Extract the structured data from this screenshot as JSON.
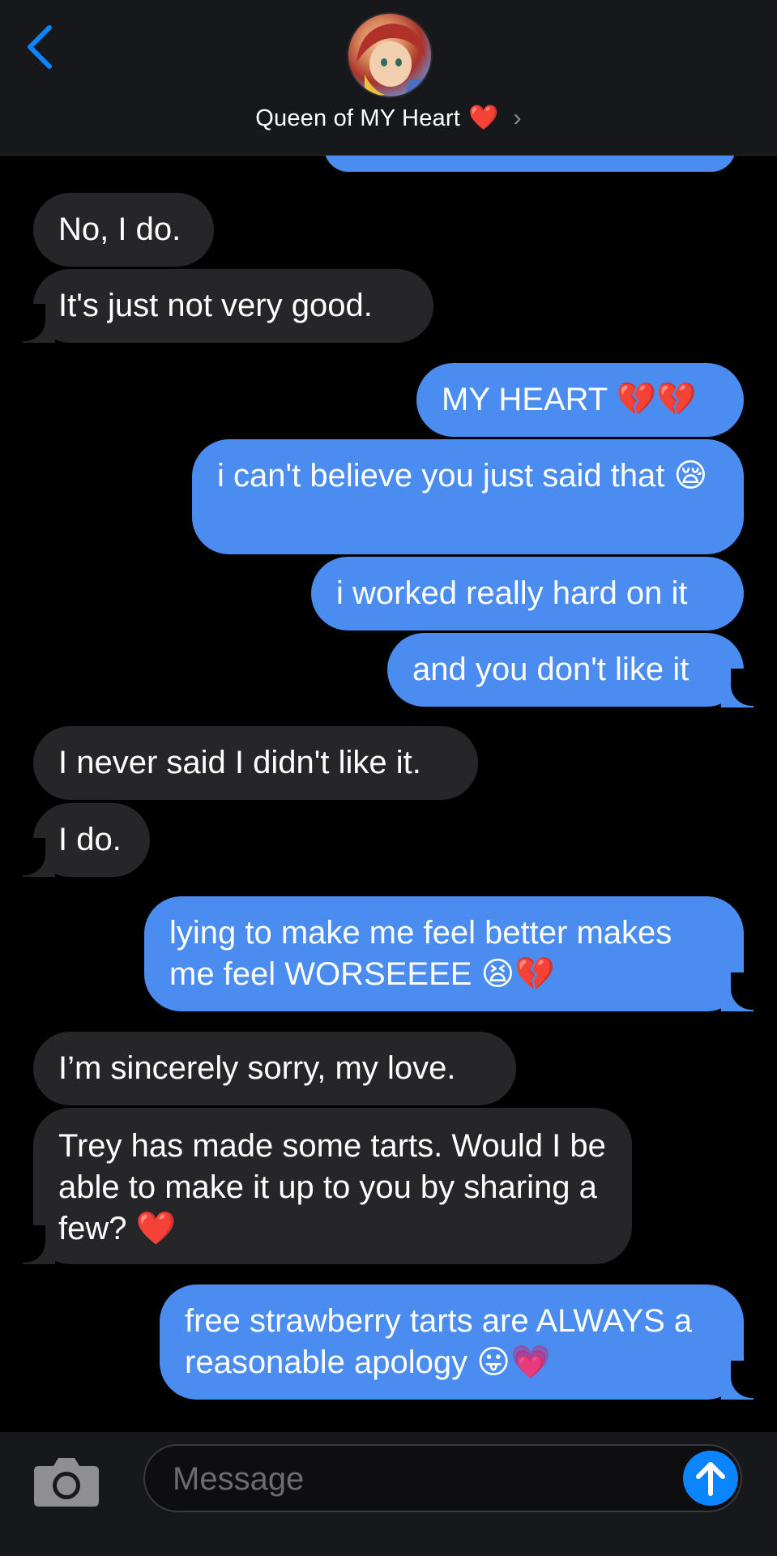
{
  "header": {
    "contact_name": "Queen of MY Heart",
    "heart_emoji": "❤️",
    "chevron": "›"
  },
  "messages": [
    {
      "from": "them",
      "text": "No, I do."
    },
    {
      "from": "them",
      "text": "It's just not very good."
    },
    {
      "from": "me",
      "text": "MY HEART 💔💔"
    },
    {
      "from": "me",
      "text": "i can't believe you just said that 😪"
    },
    {
      "from": "me",
      "text": "i worked really hard on it"
    },
    {
      "from": "me",
      "text": "and you don't like it"
    },
    {
      "from": "them",
      "text": "I never said I didn't like it."
    },
    {
      "from": "them",
      "text": "I do."
    },
    {
      "from": "me",
      "text": "lying to make me feel better makes me feel WORSEEEE 😫💔"
    },
    {
      "from": "them",
      "text": "I’m sincerely sorry, my love."
    },
    {
      "from": "them",
      "text": "Trey has made some tarts. Would I be able to make it up to you by sharing a few? ❤️"
    },
    {
      "from": "me",
      "text": "free strawberry tarts are ALWAYS a reasonable apology 😛💗"
    }
  ],
  "input": {
    "placeholder": "Message"
  },
  "icons": {
    "back": "chevron-left-icon",
    "camera": "camera-icon",
    "send": "arrow-up-icon"
  },
  "colors": {
    "sent_bubble": "#4a8cf0",
    "received_bubble": "#262629",
    "accent": "#0a84ff",
    "background": "#000000"
  }
}
